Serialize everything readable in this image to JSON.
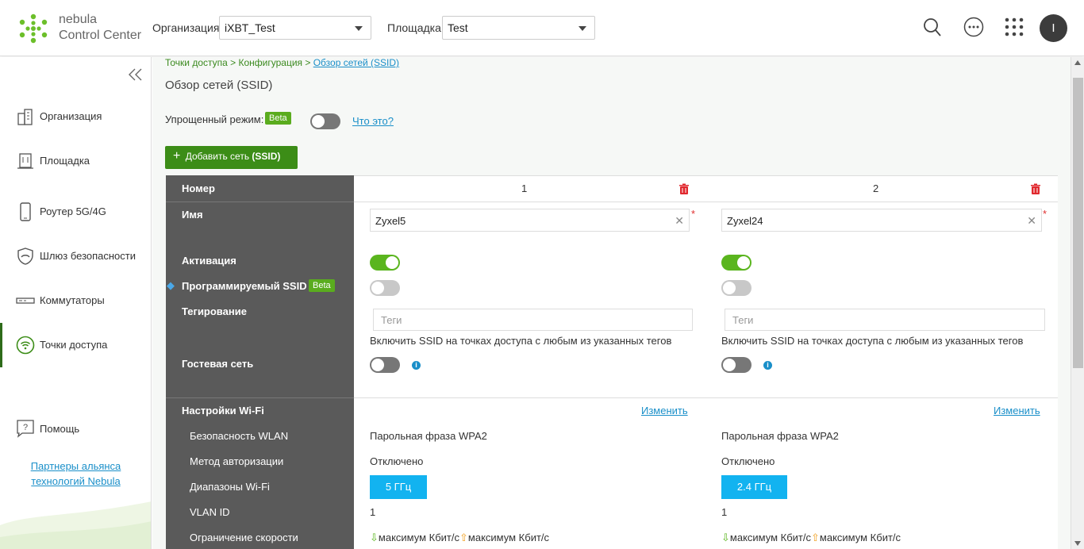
{
  "app": {
    "logo_line1": "nebula",
    "logo_line2": "Control Center"
  },
  "header": {
    "org_label": "Организация:",
    "org_value": "iXBT_Test",
    "site_label": "Площадка:",
    "site_value": "Test",
    "avatar_initial": "I"
  },
  "sidebar": {
    "items": [
      {
        "label": "Организация",
        "icon": "building-icon"
      },
      {
        "label": "Площадка",
        "icon": "site-icon"
      },
      {
        "label": "Роутер 5G/4G",
        "icon": "phone-icon"
      },
      {
        "label": "Шлюз безопасности",
        "icon": "shield-icon"
      },
      {
        "label": "Коммутаторы",
        "icon": "switch-icon"
      },
      {
        "label": "Точки доступа",
        "icon": "wifi-icon",
        "active": true
      }
    ],
    "help_label": "Помощь",
    "partners_line1": "Партнеры альянса",
    "partners_line2": "технологий Nebula"
  },
  "breadcrumb": {
    "part1": "Точки доступа > Конфигурация > ",
    "current": "Обзор сетей (SSID)"
  },
  "page": {
    "title": "Обзор сетей (SSID)",
    "simple_mode_label": "Упрощенный режим:",
    "beta": "Beta",
    "what_is_this": "Что это?",
    "add_button_prefix": "Добавить сеть",
    "add_button_bold": "(SSID)"
  },
  "table": {
    "rows": {
      "number": "Номер",
      "name": "Имя",
      "activation": "Активация",
      "programmable": "Программируемый SSID",
      "tagging": "Тегирование",
      "guest": "Гостевая сеть",
      "wifi_settings": "Настройки Wi-Fi",
      "wlan_security": "Безопасность WLAN",
      "auth_method": "Метод авторизации",
      "wifi_bands": "Диапазоны Wi-Fi",
      "vlan_id": "VLAN ID",
      "rate_limit": "Ограничение скорости"
    },
    "tags_placeholder": "Теги",
    "tags_hint": "Включить SSID на точках доступа с любым из указанных тегов",
    "edit_label": "Изменить",
    "columns": [
      {
        "number": "1",
        "name": "Zyxel5",
        "security": "Парольная фраза WPA2",
        "auth": "Отключено",
        "band": "5 ГГц",
        "vlan": "1",
        "rate_down": "максимум Кбит/с",
        "rate_up": "максимум Кбит/с"
      },
      {
        "number": "2",
        "name": "Zyxel24",
        "security": "Парольная фраза WPA2",
        "auth": "Отключено",
        "band": "2.4 ГГц",
        "vlan": "1",
        "rate_down": "максимум Кбит/с",
        "rate_up": "максимум Кбит/с"
      }
    ]
  },
  "colors": {
    "accent_green": "#3c8d17",
    "badge_green": "#5aac1e",
    "link_blue": "#1a8fc9",
    "band_blue": "#12b3f0",
    "header_gray": "#5a5a5a"
  }
}
